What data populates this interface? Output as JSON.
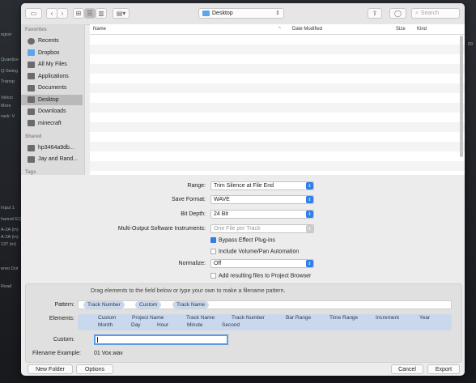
{
  "background": {
    "left_labels": [
      "egion",
      "Quantize",
      "Q-Swing",
      "Transp",
      "Veloci",
      "More",
      "rack: V",
      "Input 1",
      "hannel EQ",
      "A-2A (m)",
      "A-2A (m)",
      "137 (m)",
      "ereo Out",
      "Read"
    ],
    "right_labels": [
      "89"
    ]
  },
  "toolbar": {
    "path_label": "Desktop",
    "search_placeholder": "Search"
  },
  "sidebar": {
    "favorites_header": "Favorites",
    "favorites": [
      {
        "label": "Recents",
        "icon": "clock-icon"
      },
      {
        "label": "Dropbox",
        "icon": "dropbox-icon"
      },
      {
        "label": "All My Files",
        "icon": "files-icon"
      },
      {
        "label": "Applications",
        "icon": "applications-icon"
      },
      {
        "label": "Documents",
        "icon": "document-icon"
      },
      {
        "label": "Desktop",
        "icon": "desktop-icon",
        "selected": true
      },
      {
        "label": "Downloads",
        "icon": "download-icon"
      },
      {
        "label": "minecraft",
        "icon": "folder-icon"
      }
    ],
    "shared_header": "Shared",
    "shared": [
      {
        "label": "hp3464a9db...",
        "icon": "computer-icon"
      },
      {
        "label": "Jay and Rand...",
        "icon": "computer-icon"
      }
    ],
    "tags_header": "Tags"
  },
  "file_list": {
    "columns": {
      "name": "Name",
      "date": "Date Modified",
      "size": "Size",
      "kind": "Kind"
    }
  },
  "options": {
    "range": {
      "label": "Range:",
      "value": "Trim Silence at File End"
    },
    "save_format": {
      "label": "Save Format:",
      "value": "WAVE"
    },
    "bit_depth": {
      "label": "Bit Depth:",
      "value": "24 Bit"
    },
    "multi_output": {
      "label": "Multi-Output Software Instruments:",
      "value": "One File per Track"
    },
    "bypass_effect": {
      "label": "Bypass Effect Plug-ins",
      "checked": true
    },
    "include_automation": {
      "label": "Include Volume/Pan Automation",
      "checked": false
    },
    "normalize": {
      "label": "Normalize:",
      "value": "Off"
    },
    "add_to_browser": {
      "label": "Add resulting files to Project Browser",
      "checked": false
    }
  },
  "naming": {
    "instructions": "Drag elements to the field below or type your own to make a filename pattern.",
    "pattern_label": "Pattern:",
    "pattern_tokens": [
      "Track Number",
      "Custom",
      "Track Name"
    ],
    "elements_label": "Elements:",
    "elements_row1": [
      "Custom",
      "Project Name",
      "Track Name",
      "Track Number",
      "Bar Range",
      "Time Range",
      "Increment",
      "Year"
    ],
    "elements_row2": [
      "Month",
      "Day",
      "Hour",
      "Minute",
      "Second"
    ],
    "custom_label": "Custom:",
    "custom_value": "",
    "example_label": "Filename Example:",
    "example_value": "01 Vox.wav"
  },
  "footer": {
    "new_folder": "New Folder",
    "options": "Options",
    "cancel": "Cancel",
    "export": "Export"
  },
  "colors": {
    "accent": "#2f7fe6",
    "token": "#c9d8ec"
  }
}
